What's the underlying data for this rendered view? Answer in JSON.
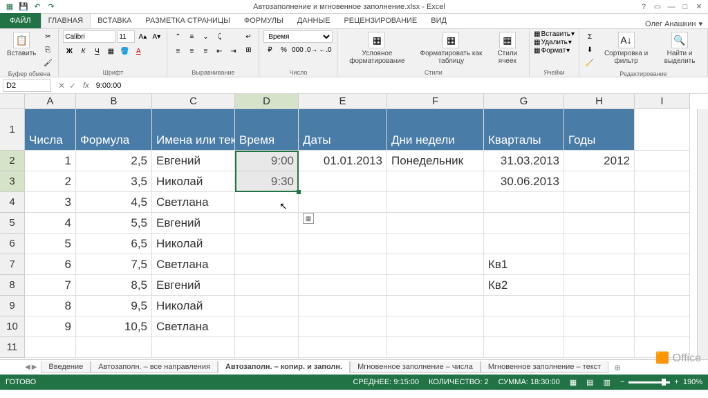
{
  "title": "Автозаполнение и мгновенное заполнение.xlsx - Excel",
  "user": "Олег Анашкин",
  "ribbon_tabs": {
    "file": "ФАЙЛ",
    "items": [
      "ГЛАВНАЯ",
      "ВСТАВКА",
      "РАЗМЕТКА СТРАНИЦЫ",
      "ФОРМУЛЫ",
      "ДАННЫЕ",
      "РЕЦЕНЗИРОВАНИЕ",
      "ВИД"
    ],
    "active": 0
  },
  "ribbon": {
    "clipboard": {
      "paste": "Вставить",
      "label": "Буфер обмена"
    },
    "font": {
      "name": "Calibri",
      "size": "11",
      "label": "Шрифт"
    },
    "align": {
      "label": "Выравнивание"
    },
    "number": {
      "format": "Время",
      "label": "Число"
    },
    "styles": {
      "cond": "Условное форматирование",
      "table": "Форматировать как таблицу",
      "cell": "Стили ячеек",
      "label": "Стили"
    },
    "cells": {
      "insert": "Вставить",
      "delete": "Удалить",
      "format": "Формат",
      "label": "Ячейки"
    },
    "editing": {
      "sort": "Сортировка и фильтр",
      "find": "Найти и выделить",
      "label": "Редактирование"
    }
  },
  "name_box": "D2",
  "formula": "9:00:00",
  "columns": [
    "A",
    "B",
    "C",
    "D",
    "E",
    "F",
    "G",
    "H",
    "I"
  ],
  "rows": [
    "1",
    "2",
    "3",
    "4",
    "5",
    "6",
    "7",
    "8",
    "9",
    "10",
    "11"
  ],
  "headers": {
    "A": "Числа",
    "B": "Формула",
    "C": "Имена или текст",
    "D": "Время",
    "E": "Даты",
    "F": "Дни недели",
    "G": "Кварталы",
    "H": "Годы"
  },
  "data": {
    "r2": {
      "A": "1",
      "B": "2,5",
      "C": "Евгений",
      "D": "9:00",
      "E": "01.01.2013",
      "F": "Понедельник",
      "G": "31.03.2013",
      "H": "2012"
    },
    "r3": {
      "A": "2",
      "B": "3,5",
      "C": "Николай",
      "D": "9:30",
      "E": "",
      "F": "",
      "G": "30.06.2013",
      "H": ""
    },
    "r4": {
      "A": "3",
      "B": "4,5",
      "C": "Светлана"
    },
    "r5": {
      "A": "4",
      "B": "5,5",
      "C": "Евгений"
    },
    "r6": {
      "A": "5",
      "B": "6,5",
      "C": "Николай"
    },
    "r7": {
      "A": "6",
      "B": "7,5",
      "C": "Светлана",
      "G": "Кв1"
    },
    "r8": {
      "A": "7",
      "B": "8,5",
      "C": "Евгений",
      "G": "Кв2"
    },
    "r9": {
      "A": "8",
      "B": "9,5",
      "C": "Николай"
    },
    "r10": {
      "A": "9",
      "B": "10,5",
      "C": "Светлана"
    }
  },
  "sheets": {
    "items": [
      "Введение",
      "Автозаполн. – все направления",
      "Автозаполн. – копир. и заполн.",
      "Мгновенное заполнение – числа",
      "Мгновенное заполнение – текст"
    ],
    "active": 2
  },
  "status": {
    "ready": "ГОТОВО",
    "avg_label": "СРЕДНЕЕ:",
    "avg": "9:15:00",
    "count_label": "КОЛИЧЕСТВО:",
    "count": "2",
    "sum_label": "СУММА:",
    "sum": "18:30:00",
    "zoom": "190%"
  },
  "office_mark": "Office"
}
